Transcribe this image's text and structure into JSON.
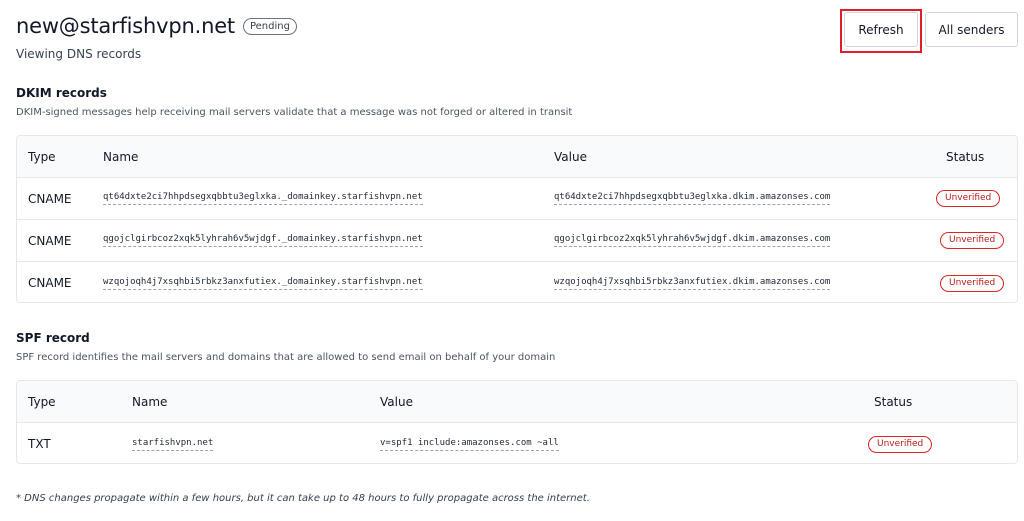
{
  "header": {
    "title": "new@starfishvpn.net",
    "status_badge": "Pending",
    "subtitle": "Viewing DNS records"
  },
  "toolbar": {
    "refresh_label": "Refresh",
    "all_senders_label": "All senders"
  },
  "dkim": {
    "title": "DKIM records",
    "description": "DKIM-signed messages help receiving mail servers validate that a message was not forged or altered in transit",
    "columns": {
      "type": "Type",
      "name": "Name",
      "value": "Value",
      "status": "Status"
    },
    "rows": [
      {
        "type": "CNAME",
        "name": "qt64dxte2ci7hhpdsegxqbbtu3eglxka._domainkey.starfishvpn.net",
        "value": "qt64dxte2ci7hhpdsegxqbbtu3eglxka.dkim.amazonses.com",
        "status": "Unverified"
      },
      {
        "type": "CNAME",
        "name": "qgojclgirbcoz2xqk5lyhrah6v5wjdgf._domainkey.starfishvpn.net",
        "value": "qgojclgirbcoz2xqk5lyhrah6v5wjdgf.dkim.amazonses.com",
        "status": "Unverified"
      },
      {
        "type": "CNAME",
        "name": "wzqojoqh4j7xsqhbi5rbkz3anxfutiex._domainkey.starfishvpn.net",
        "value": "wzqojoqh4j7xsqhbi5rbkz3anxfutiex.dkim.amazonses.com",
        "status": "Unverified"
      }
    ]
  },
  "spf": {
    "title": "SPF record",
    "description": "SPF record identifies the mail servers and domains that are allowed to send email on behalf of your domain",
    "columns": {
      "type": "Type",
      "name": "Name",
      "value": "Value",
      "status": "Status"
    },
    "rows": [
      {
        "type": "TXT",
        "name": "starfishvpn.net",
        "value": "v=spf1 include:amazonses.com ~all",
        "status": "Unverified"
      }
    ]
  },
  "footnote": "* DNS changes propagate within a few hours, but it can take up to 48 hours to fully propagate across the internet.",
  "colors": {
    "unverified": "#dc2626",
    "highlight": "#e11d2a",
    "header_bg": "#f9fafb",
    "border": "#e5e7eb"
  }
}
